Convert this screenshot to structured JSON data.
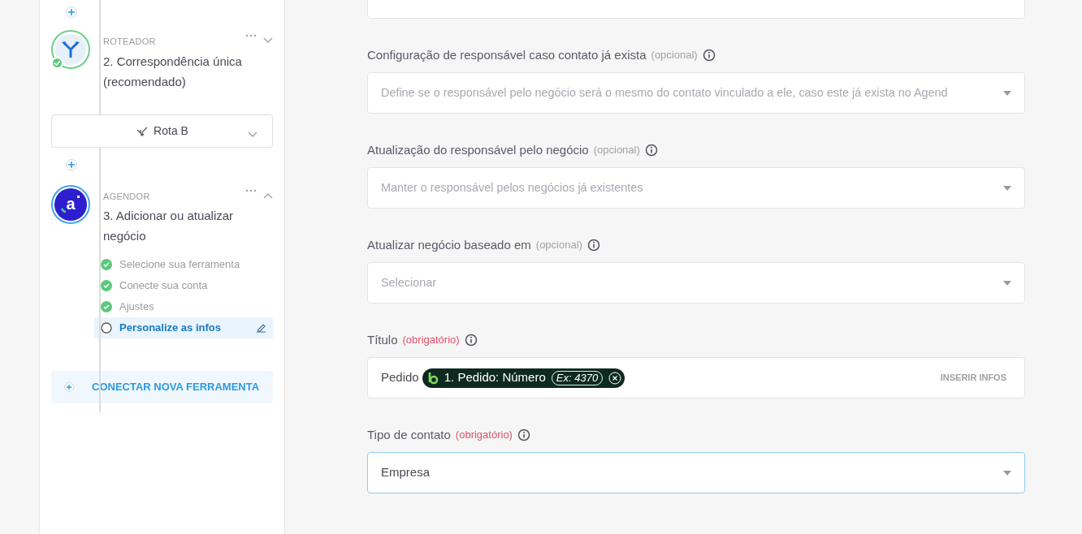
{
  "steps": [
    {
      "app": "ROTEADOR",
      "title": "2. Correspondência única (recomendado)",
      "kind": "router",
      "expanded": false,
      "done": true,
      "route": {
        "label": "Rota B"
      }
    },
    {
      "app": "AGENDOR",
      "title": "3. Adicionar ou atualizar negócio",
      "kind": "app",
      "logo_letter": "a",
      "expanded": true,
      "done": false,
      "substeps": [
        {
          "label": "Selecione sua ferramenta",
          "checked": true,
          "selected": false
        },
        {
          "label": "Conecte sua conta",
          "checked": true,
          "selected": false
        },
        {
          "label": "Ajustes",
          "checked": true,
          "selected": false
        },
        {
          "label": "Personalize as infos",
          "checked": false,
          "selected": true
        }
      ]
    }
  ],
  "connect_button": {
    "label": "CONECTAR NOVA FERRAMENTA"
  },
  "fields": [
    {
      "kind": "select",
      "label": "Configuração de responsável caso contato já exista",
      "tag": "(opcional)",
      "required": false,
      "placeholder": "Define se o responsável pelo negócio será o mesmo do contato vinculado a ele, caso este já exista no Agend",
      "focused": false
    },
    {
      "kind": "select",
      "label": "Atualização do responsável pelo negócio",
      "tag": "(opcional)",
      "required": false,
      "placeholder": "Manter o responsável pelos negócios já existentes",
      "focused": false
    },
    {
      "kind": "select",
      "label": "Atualizar negócio baseado em",
      "tag": "(opcional)",
      "required": false,
      "placeholder": "Selecionar",
      "focused": false
    },
    {
      "kind": "text",
      "label": "Título",
      "tag": "(obrigatório)",
      "required": true,
      "prefix": "Pedido",
      "chip": {
        "label": "1. Pedido: Número",
        "example": "Ex: 4370"
      },
      "action": "INSERIR INFOS",
      "focused": false
    },
    {
      "kind": "select",
      "label": "Tipo de contato",
      "tag": "(obrigatório)",
      "required": true,
      "value": "Empresa",
      "focused": true
    }
  ]
}
